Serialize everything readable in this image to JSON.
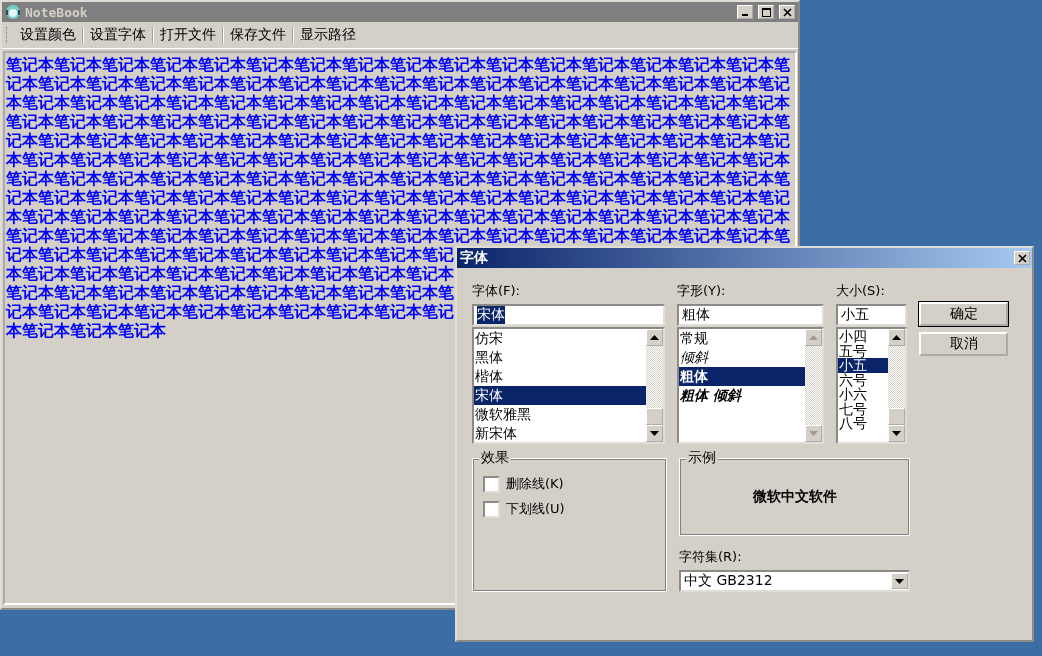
{
  "notebook": {
    "title": "NoteBook",
    "toolbar": [
      "设置颜色",
      "设置字体",
      "打开文件",
      "保存文件",
      "显示路径"
    ],
    "text_lines": [
      "笔记本笔记本笔记本笔记本笔记本笔记本笔记本笔记本笔记本笔记本笔记本笔记本笔记本笔记本笔记本笔记本笔",
      "记本笔记本笔记本笔记本笔记本笔记本笔记本笔记本笔记本笔记本笔记本笔记本笔记本笔记本笔记本笔记本笔记",
      "本笔记本笔记本笔记本笔记本笔记本笔记本笔记本笔记本笔记本笔记本笔记本笔记本笔记本笔记本笔记本笔记本",
      "笔记本笔记本笔记本笔记本笔记本笔记本笔记本笔记本笔记本笔记本笔记本笔记本笔记本笔记本笔记本笔记本笔",
      "记本笔记本笔记本笔记本笔记本笔记本笔记本笔记本笔记本笔记本笔记本笔记本笔记本笔记本笔记本笔记本笔记",
      "本笔记本笔记本笔记本笔记本笔记本笔记本笔记本笔记本笔记本笔记本笔记本笔记本笔记本笔记本笔记本笔记本",
      "笔记本笔记本笔记本笔记本笔记本笔记本笔记本笔记本笔记本笔记本笔记本笔记本笔记本笔记本笔记本笔记本笔",
      "记本笔记本笔记本笔记本笔记本笔记本笔记本笔记本笔记本笔记本笔记本笔记本笔记本笔记本笔记本笔记本笔记",
      "本笔记本笔记本笔记本笔记本笔记本笔记本笔记本笔记本笔记本笔记本笔记本笔记本笔记本笔记本笔记本笔记本",
      "笔记本笔记本笔记本笔记本笔记本笔记本笔记本笔记本笔记本笔记本笔记本笔记本笔记本笔记本笔记本笔记本笔",
      "记本笔记本笔记本笔记本笔记本笔记本笔记本笔记本笔记本笔记",
      "本笔记本笔记本笔记本笔记本笔记本笔记本笔记本笔记本笔记本",
      "笔记本笔记本笔记本笔记本笔记本笔记本笔记本笔记本笔记本笔",
      "记本笔记本笔记本笔记本笔记本笔记本笔记本笔记本笔记本笔记",
      "本笔记本笔记本笔记本"
    ]
  },
  "font_dialog": {
    "title": "字体",
    "font": {
      "label": "字体(F):",
      "value": "宋体",
      "items": [
        {
          "label": "仿宋",
          "selected": false
        },
        {
          "label": "黑体",
          "selected": false
        },
        {
          "label": "楷体",
          "selected": false
        },
        {
          "label": "宋体",
          "selected": true
        },
        {
          "label": "微软雅黑",
          "selected": false
        },
        {
          "label": "新宋体",
          "selected": false
        }
      ]
    },
    "style": {
      "label": "字形(Y):",
      "value": "粗体",
      "items": [
        {
          "label": "常规",
          "kind": "regular",
          "selected": false
        },
        {
          "label": "倾斜",
          "kind": "italic",
          "selected": false
        },
        {
          "label": "粗体",
          "kind": "bold",
          "selected": true
        },
        {
          "label": "粗体 倾斜",
          "kind": "bold-italic",
          "selected": false
        }
      ]
    },
    "size": {
      "label": "大小(S):",
      "value": "小五",
      "items": [
        {
          "label": "小四",
          "selected": false
        },
        {
          "label": "五号",
          "selected": false
        },
        {
          "label": "小五",
          "selected": true
        },
        {
          "label": "六号",
          "selected": false
        },
        {
          "label": "小六",
          "selected": false
        },
        {
          "label": "七号",
          "selected": false
        },
        {
          "label": "八号",
          "selected": false
        }
      ]
    },
    "buttons": [
      "确定",
      "取消"
    ],
    "effects": {
      "title": "效果",
      "options": [
        {
          "label": "删除线(K)",
          "checked": false
        },
        {
          "label": "下划线(U)",
          "checked": false
        }
      ]
    },
    "sample": {
      "title": "示例",
      "text": "微软中文软件"
    },
    "charset": {
      "label": "字符集(R):",
      "value": "中文 GB2312"
    }
  }
}
